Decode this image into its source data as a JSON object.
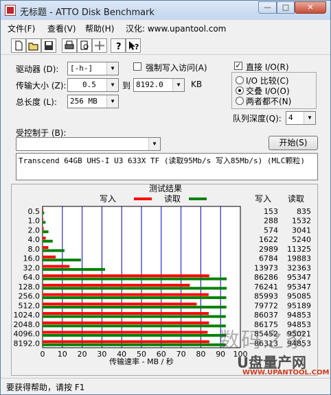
{
  "window": {
    "title": "无标题 - ATTO Disk Benchmark",
    "min_glyph": "—",
    "max_glyph": "□",
    "close_glyph": "✕"
  },
  "menu": {
    "file": "文件(F)",
    "view": "查看(V)",
    "help": "帮助(H)",
    "credit": "汉化: www.upantool.com"
  },
  "toolbar": {
    "icons": [
      "new-file-icon",
      "open-file-icon",
      "save-icon",
      "print-icon",
      "print-preview-icon",
      "move-icon",
      "help-icon",
      "context-help-icon"
    ]
  },
  "settings": {
    "drive_label": "驱动器 (D):",
    "drive_value": "[-h-]",
    "transfer_label": "传输大小 (Z):",
    "transfer_from": "0.5",
    "transfer_to_label": "到",
    "transfer_to": "8192.0",
    "transfer_unit": "KB",
    "total_label": "总长度 (L):",
    "total_value": "256 MB",
    "force_write_label": "强制写入访问(A)",
    "force_write_checked": false
  },
  "io": {
    "direct_label": "直接 I/O(R)",
    "direct_checked": true,
    "compare_label": "I/O 比较(C)",
    "overlap_label": "交叠 I/O(O)",
    "neither_label": "两者都不(N)",
    "selected": "overlap",
    "queue_label": "队列深度(Q):",
    "queue_value": "4"
  },
  "controlled": {
    "label": "受控制于 (B):",
    "value": ""
  },
  "start_button": "开始(S)",
  "description": "Transcend 64GB UHS-I U3 633X TF (读取95Mb/s 写入85Mb/s) (MLC颗粒)",
  "results": {
    "title": "测试结果",
    "legend_write": "写入",
    "legend_read": "读取",
    "col_write": "写入",
    "col_read": "读取",
    "write_color": "#ff0000",
    "read_color": "#008000",
    "xlabel": "传输速率 - MB / 秒",
    "xticks": [
      "0",
      "10",
      "20",
      "30",
      "40",
      "50",
      "60",
      "70",
      "80",
      "90",
      "100"
    ],
    "rows": [
      {
        "size": "0.5",
        "write": "153",
        "read": "835"
      },
      {
        "size": "1.0",
        "write": "288",
        "read": "1532"
      },
      {
        "size": "2.0",
        "write": "574",
        "read": "3041"
      },
      {
        "size": "4.0",
        "write": "1622",
        "read": "5240"
      },
      {
        "size": "8.0",
        "write": "2989",
        "read": "11325"
      },
      {
        "size": "16.0",
        "write": "6784",
        "read": "19883"
      },
      {
        "size": "32.0",
        "write": "13973",
        "read": "32363"
      },
      {
        "size": "64.0",
        "write": "86286",
        "read": "95347"
      },
      {
        "size": "128.0",
        "write": "76241",
        "read": "95347"
      },
      {
        "size": "256.0",
        "write": "85993",
        "read": "95085"
      },
      {
        "size": "512.0",
        "write": "79772",
        "read": "95189"
      },
      {
        "size": "1024.0",
        "write": "86037",
        "read": "94853"
      },
      {
        "size": "2048.0",
        "write": "86175",
        "read": "94853"
      },
      {
        "size": "4096.0",
        "write": "85452",
        "read": "95021"
      },
      {
        "size": "8192.0",
        "write": "86313",
        "read": "94853"
      }
    ]
  },
  "chart_data": {
    "type": "bar",
    "title": "测试结果",
    "xlabel": "传输速率 - MB / 秒",
    "ylabel": "",
    "xlim": [
      0,
      100
    ],
    "orientation": "horizontal",
    "grid": true,
    "categories": [
      "0.5",
      "1.0",
      "2.0",
      "4.0",
      "8.0",
      "16.0",
      "32.0",
      "64.0",
      "128.0",
      "256.0",
      "512.0",
      "1024.0",
      "2048.0",
      "4096.0",
      "8192.0"
    ],
    "series": [
      {
        "name": "写入",
        "values": [
          0.15,
          0.28,
          0.56,
          1.58,
          2.92,
          6.63,
          13.65,
          84.26,
          74.45,
          83.98,
          77.9,
          84.02,
          84.16,
          83.45,
          84.29
        ]
      },
      {
        "name": "读取",
        "values": [
          0.82,
          1.5,
          2.97,
          5.12,
          11.06,
          19.42,
          31.6,
          93.11,
          93.11,
          92.86,
          92.96,
          92.63,
          92.63,
          92.79,
          92.63
        ]
      }
    ]
  },
  "watermark": {
    "line1": "数码之家",
    "line2": "U盘量产网",
    "line3": "WWW.UPANTOOL.COM"
  },
  "status": "要获得帮助，请按 F1"
}
